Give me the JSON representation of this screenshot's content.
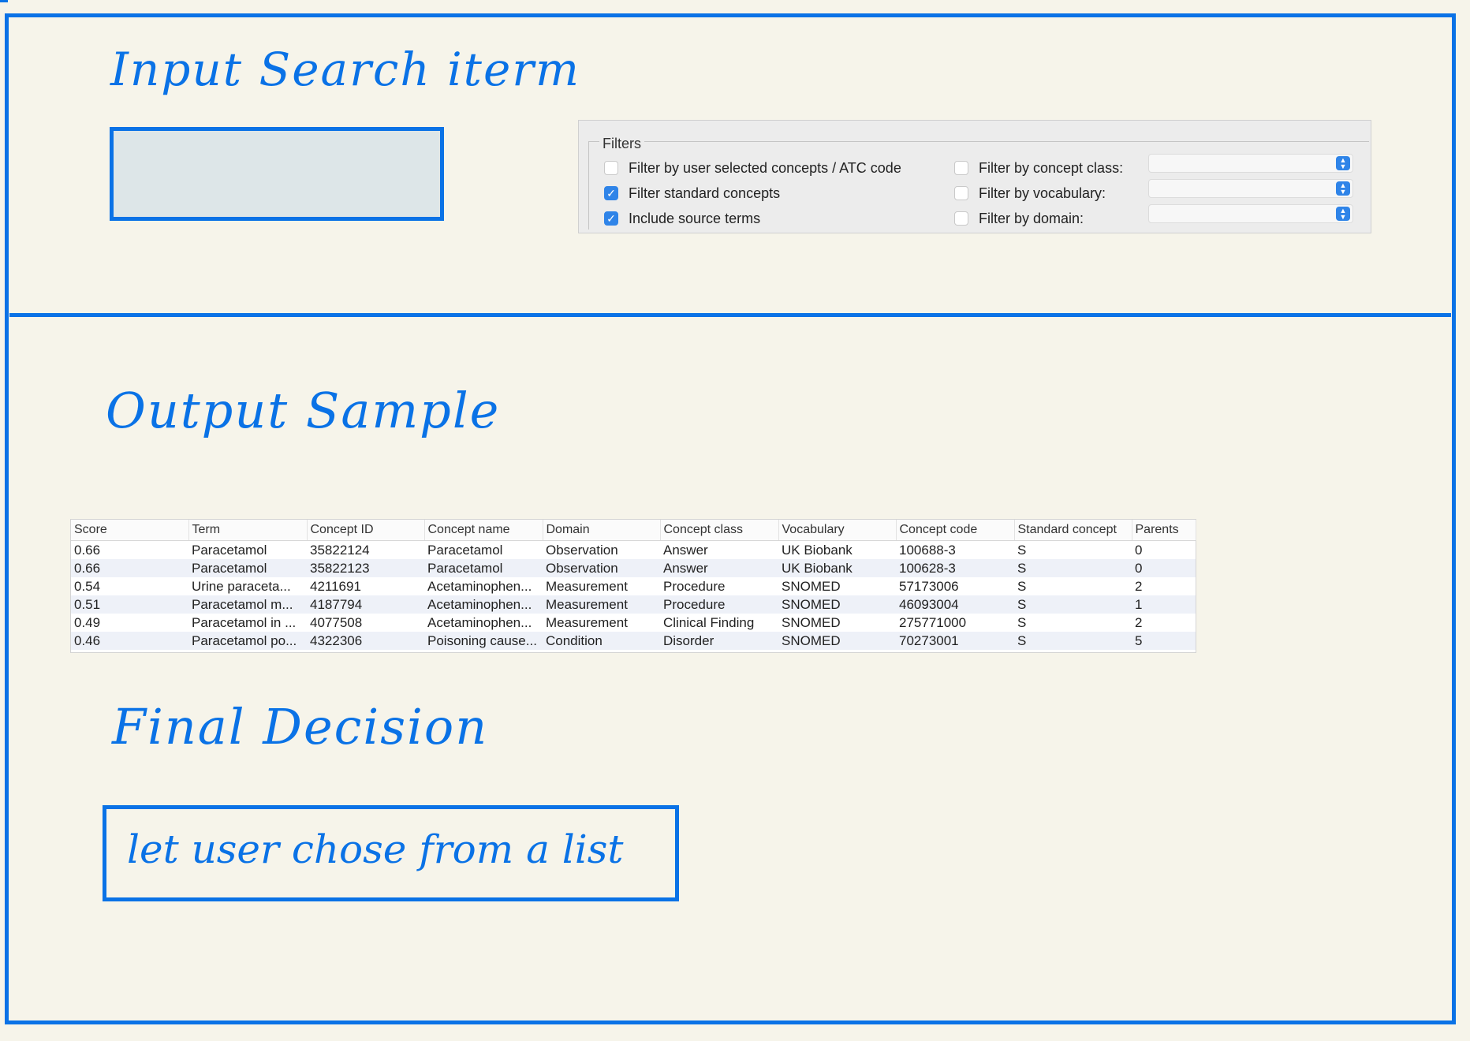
{
  "colors": {
    "accent": "#0a72e6",
    "background": "#f6f4ea",
    "checkbox_checked": "#2f84e8"
  },
  "input_section": {
    "title": "Input Search iterm"
  },
  "filters": {
    "legend": "Filters",
    "left_options": [
      {
        "label": "Filter by user selected concepts / ATC code",
        "checked": false
      },
      {
        "label": "Filter standard concepts",
        "checked": true
      },
      {
        "label": "Include source terms",
        "checked": true
      }
    ],
    "right_options": [
      {
        "label": "Filter by concept class:",
        "checked": false,
        "selected": ""
      },
      {
        "label": "Filter by vocabulary:",
        "checked": false,
        "selected": ""
      },
      {
        "label": "Filter by domain:",
        "checked": false,
        "selected": ""
      }
    ]
  },
  "output_section": {
    "title": "Output Sample"
  },
  "results_table": {
    "columns": [
      "Score",
      "Term",
      "Concept ID",
      "Concept name",
      "Domain",
      "Concept class",
      "Vocabulary",
      "Concept code",
      "Standard concept",
      "Parents"
    ],
    "rows": [
      [
        "0.66",
        "Paracetamol",
        "35822124",
        "Paracetamol",
        "Observation",
        "Answer",
        "UK Biobank",
        "100688-3",
        "S",
        "0"
      ],
      [
        "0.66",
        "Paracetamol",
        "35822123",
        "Paracetamol",
        "Observation",
        "Answer",
        "UK Biobank",
        "100628-3",
        "S",
        "0"
      ],
      [
        "0.54",
        "Urine paraceta...",
        "4211691",
        "Acetaminophen...",
        "Measurement",
        "Procedure",
        "SNOMED",
        "57173006",
        "S",
        "2"
      ],
      [
        "0.51",
        "Paracetamol m...",
        "4187794",
        "Acetaminophen...",
        "Measurement",
        "Procedure",
        "SNOMED",
        "46093004",
        "S",
        "1"
      ],
      [
        "0.49",
        "Paracetamol in ...",
        "4077508",
        "Acetaminophen...",
        "Measurement",
        "Clinical Finding",
        "SNOMED",
        "275771000",
        "S",
        "2"
      ],
      [
        "0.46",
        "Paracetamol po...",
        "4322306",
        "Poisoning cause...",
        "Condition",
        "Disorder",
        "SNOMED",
        "70273001",
        "S",
        "5"
      ]
    ]
  },
  "decision_section": {
    "title": "Final Decision",
    "box_text": "let user chose from a list"
  }
}
